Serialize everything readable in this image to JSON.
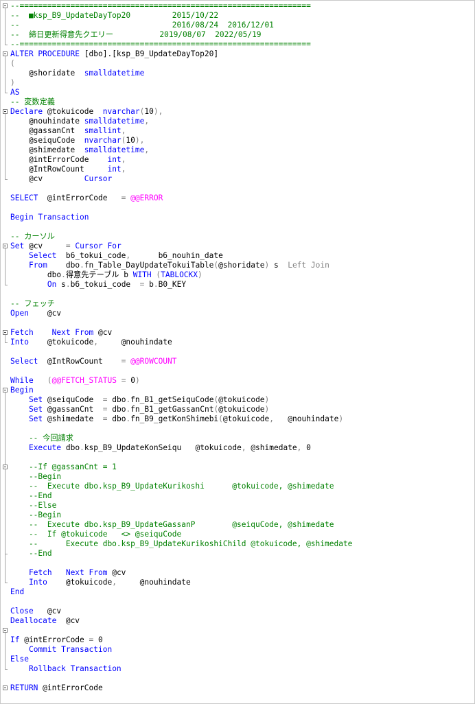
{
  "colors": {
    "keyword": "#0000ff",
    "system": "#ff00ff",
    "comment": "#008000",
    "gray": "#808080",
    "string": "#ff0000",
    "text": "#000000",
    "border": "#c8c8c8"
  },
  "lines": [
    [
      [
        "com",
        "--==============================================================="
      ]
    ],
    [
      [
        "com",
        "--  ■ksp_B9_UpdateDayTop20         2015/10/22"
      ]
    ],
    [
      [
        "com",
        "--                                 2016/08/24  2016/12/01"
      ]
    ],
    [
      [
        "com",
        "--  締日更新得意先クエリー          2019/08/07  2022/05/19"
      ]
    ],
    [
      [
        "com",
        "--==============================================================="
      ]
    ],
    [
      [
        "kw",
        "ALTER PROCEDURE "
      ],
      [
        "txt",
        "[dbo].[ksp_B9_UpdateDayTop20]"
      ]
    ],
    [
      [
        "gray",
        "("
      ]
    ],
    [
      [
        "txt",
        "    @shoridate  "
      ],
      [
        "kw",
        "smalldatetime"
      ]
    ],
    [
      [
        "gray",
        ")"
      ]
    ],
    [
      [
        "kw",
        "AS"
      ]
    ],
    [
      [
        "com",
        "-- 変数定義"
      ]
    ],
    [
      [
        "kw",
        "Declare "
      ],
      [
        "txt",
        "@tokuicode  "
      ],
      [
        "kw",
        "nvarchar"
      ],
      [
        "gray",
        "("
      ],
      [
        "txt",
        "10"
      ],
      [
        "gray",
        "),"
      ]
    ],
    [
      [
        "txt",
        "    @nouhindate "
      ],
      [
        "kw",
        "smalldatetime"
      ],
      [
        "gray",
        ","
      ]
    ],
    [
      [
        "txt",
        "    @gassanCnt  "
      ],
      [
        "kw",
        "smallint"
      ],
      [
        "gray",
        ","
      ]
    ],
    [
      [
        "txt",
        "    @seiquCode  "
      ],
      [
        "kw",
        "nvarchar"
      ],
      [
        "gray",
        "("
      ],
      [
        "txt",
        "10"
      ],
      [
        "gray",
        "),"
      ]
    ],
    [
      [
        "txt",
        "    @shimedate  "
      ],
      [
        "kw",
        "smalldatetime"
      ],
      [
        "gray",
        ","
      ]
    ],
    [
      [
        "txt",
        "    @intErrorCode    "
      ],
      [
        "kw",
        "int"
      ],
      [
        "gray",
        ","
      ]
    ],
    [
      [
        "txt",
        "    @IntRowCount     "
      ],
      [
        "kw",
        "int"
      ],
      [
        "gray",
        ","
      ]
    ],
    [
      [
        "txt",
        "    @cv         "
      ],
      [
        "kw",
        "Cursor"
      ]
    ],
    [],
    [
      [
        "kw",
        "SELECT"
      ],
      [
        "txt",
        "  @intErrorCode   "
      ],
      [
        "gray",
        "= "
      ],
      [
        "sys",
        "@@ERROR"
      ]
    ],
    [],
    [
      [
        "kw",
        "Begin Transaction"
      ]
    ],
    [],
    [
      [
        "com",
        "-- カーソル"
      ]
    ],
    [
      [
        "kw",
        "Set "
      ],
      [
        "txt",
        "@cv     "
      ],
      [
        "gray",
        "= "
      ],
      [
        "kw",
        "Cursor For"
      ]
    ],
    [
      [
        "txt",
        "    "
      ],
      [
        "kw",
        "Select  "
      ],
      [
        "txt",
        "b6_tokui_code"
      ],
      [
        "gray",
        ","
      ],
      [
        "txt",
        "      b6_nouhin_date"
      ]
    ],
    [
      [
        "txt",
        "    "
      ],
      [
        "kw",
        "From    "
      ],
      [
        "txt",
        "dbo"
      ],
      [
        "gray",
        "."
      ],
      [
        "txt",
        "fn_Table_DayUpdateTokuiTable"
      ],
      [
        "gray",
        "("
      ],
      [
        "txt",
        "@shoridate"
      ],
      [
        "gray",
        ")"
      ],
      [
        "txt",
        " s  "
      ],
      [
        "gray",
        "Left Join"
      ]
    ],
    [
      [
        "txt",
        "        dbo"
      ],
      [
        "gray",
        "."
      ],
      [
        "txt",
        "得意先テーブル b "
      ],
      [
        "kw",
        "WITH "
      ],
      [
        "gray",
        "("
      ],
      [
        "kw",
        "TABLOCKX"
      ],
      [
        "gray",
        ")"
      ]
    ],
    [
      [
        "txt",
        "        "
      ],
      [
        "kw",
        "On "
      ],
      [
        "txt",
        "s"
      ],
      [
        "gray",
        "."
      ],
      [
        "txt",
        "b6_tokui_code  "
      ],
      [
        "gray",
        "= "
      ],
      [
        "txt",
        "b"
      ],
      [
        "gray",
        "."
      ],
      [
        "txt",
        "B0_KEY"
      ]
    ],
    [],
    [
      [
        "com",
        "-- フェッチ"
      ]
    ],
    [
      [
        "kw",
        "Open"
      ],
      [
        "txt",
        "    @cv"
      ]
    ],
    [],
    [
      [
        "kw",
        "Fetch    Next From "
      ],
      [
        "txt",
        "@cv"
      ]
    ],
    [
      [
        "kw",
        "Into"
      ],
      [
        "txt",
        "    @tokuicode"
      ],
      [
        "gray",
        ","
      ],
      [
        "txt",
        "     @nouhindate"
      ]
    ],
    [],
    [
      [
        "kw",
        "Select"
      ],
      [
        "txt",
        "  @IntRowCount    "
      ],
      [
        "gray",
        "= "
      ],
      [
        "sys",
        "@@ROWCOUNT"
      ]
    ],
    [],
    [
      [
        "kw",
        "While"
      ],
      [
        "txt",
        "   "
      ],
      [
        "gray",
        "("
      ],
      [
        "sys",
        "@@FETCH_STATUS "
      ],
      [
        "gray",
        "= "
      ],
      [
        "txt",
        "0"
      ],
      [
        "gray",
        ")"
      ]
    ],
    [
      [
        "kw",
        "Begin"
      ]
    ],
    [
      [
        "txt",
        "    "
      ],
      [
        "kw",
        "Set "
      ],
      [
        "txt",
        "@seiquCode  "
      ],
      [
        "gray",
        "= "
      ],
      [
        "txt",
        "dbo"
      ],
      [
        "gray",
        "."
      ],
      [
        "txt",
        "fn_B1_getSeiquCode"
      ],
      [
        "gray",
        "("
      ],
      [
        "txt",
        "@tokuicode"
      ],
      [
        "gray",
        ")"
      ]
    ],
    [
      [
        "txt",
        "    "
      ],
      [
        "kw",
        "Set "
      ],
      [
        "txt",
        "@gassanCnt  "
      ],
      [
        "gray",
        "= "
      ],
      [
        "txt",
        "dbo"
      ],
      [
        "gray",
        "."
      ],
      [
        "txt",
        "fn_B1_getGassanCnt"
      ],
      [
        "gray",
        "("
      ],
      [
        "txt",
        "@tokuicode"
      ],
      [
        "gray",
        ")"
      ]
    ],
    [
      [
        "txt",
        "    "
      ],
      [
        "kw",
        "Set "
      ],
      [
        "txt",
        "@shimedate  "
      ],
      [
        "gray",
        "= "
      ],
      [
        "txt",
        "dbo"
      ],
      [
        "gray",
        "."
      ],
      [
        "txt",
        "fn_B9_getKonShimebi"
      ],
      [
        "gray",
        "("
      ],
      [
        "txt",
        "@tokuicode"
      ],
      [
        "gray",
        ","
      ],
      [
        "txt",
        "   @nouhindate"
      ],
      [
        "gray",
        ")"
      ]
    ],
    [],
    [
      [
        "com",
        "    -- 今回請求"
      ]
    ],
    [
      [
        "txt",
        "    "
      ],
      [
        "kw",
        "Execute "
      ],
      [
        "txt",
        "dbo"
      ],
      [
        "gray",
        "."
      ],
      [
        "txt",
        "ksp_B9_UpdateKonSeiqu   @tokuicode"
      ],
      [
        "gray",
        ","
      ],
      [
        "txt",
        " @shimedate"
      ],
      [
        "gray",
        ","
      ],
      [
        "txt",
        " 0"
      ]
    ],
    [],
    [
      [
        "com",
        "    --If @gassanCnt = 1"
      ]
    ],
    [
      [
        "com",
        "    --Begin"
      ]
    ],
    [
      [
        "com",
        "    --  Execute dbo.ksp_B9_UpdateKurikoshi      @tokuicode, @shimedate"
      ]
    ],
    [
      [
        "com",
        "    --End"
      ]
    ],
    [
      [
        "com",
        "    --Else"
      ]
    ],
    [
      [
        "com",
        "    --Begin"
      ]
    ],
    [
      [
        "com",
        "    --  Execute dbo.ksp_B9_UpdateGassanP        @seiquCode, @shimedate"
      ]
    ],
    [
      [
        "com",
        "    --  If @tokuicode   <> @seiquCode"
      ]
    ],
    [
      [
        "com",
        "    --      Execute dbo.ksp_B9_UpdateKurikoshiChild @tokuicode, @shimedate"
      ]
    ],
    [
      [
        "com",
        "    --End"
      ]
    ],
    [],
    [
      [
        "txt",
        "    "
      ],
      [
        "kw",
        "Fetch   Next From "
      ],
      [
        "txt",
        "@cv"
      ]
    ],
    [
      [
        "txt",
        "    "
      ],
      [
        "kw",
        "Into"
      ],
      [
        "txt",
        "    @tokuicode"
      ],
      [
        "gray",
        ","
      ],
      [
        "txt",
        "     @nouhindate"
      ]
    ],
    [
      [
        "kw",
        "End"
      ]
    ],
    [],
    [
      [
        "kw",
        "Close"
      ],
      [
        "txt",
        "   @cv"
      ]
    ],
    [
      [
        "kw",
        "Deallocate"
      ],
      [
        "txt",
        "  @cv"
      ]
    ],
    [],
    [
      [
        "kw",
        "If "
      ],
      [
        "txt",
        "@intErrorCode "
      ],
      [
        "gray",
        "= "
      ],
      [
        "txt",
        "0"
      ]
    ],
    [
      [
        "txt",
        "    "
      ],
      [
        "kw",
        "Commit Transaction"
      ]
    ],
    [
      [
        "kw",
        "Else"
      ]
    ],
    [
      [
        "txt",
        "    "
      ],
      [
        "kw",
        "Rollback Transaction"
      ]
    ],
    [],
    [
      [
        "kw",
        "RETURN "
      ],
      [
        "txt",
        "@intErrorCode"
      ]
    ]
  ],
  "folds": [
    {
      "start": 0,
      "end": 4
    },
    {
      "start": 5,
      "end": 9
    },
    {
      "start": 11,
      "end": 18
    },
    {
      "start": 25,
      "end": 29
    },
    {
      "start": 34,
      "end": 35
    },
    {
      "start": 40,
      "end": 60
    },
    {
      "start": 48,
      "end": 57
    },
    {
      "start": 65,
      "end": 69
    },
    {
      "start": 71,
      "end": 71
    }
  ]
}
